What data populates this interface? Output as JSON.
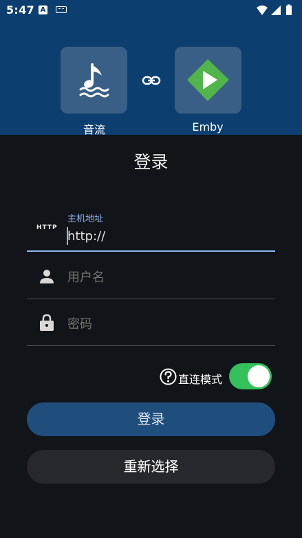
{
  "statusbar": {
    "time": "5:47",
    "notif_icon": "a-notification-icon",
    "keyboard_icon": "keyboard-icon",
    "wifi_icon": "wifi-icon",
    "signal_icon": "signal-icon",
    "battery_icon": "battery-icon"
  },
  "header": {
    "left_app": {
      "label": "音流",
      "icon": "music-note-wave-icon"
    },
    "right_app": {
      "label": "Emby",
      "icon": "emby-play-icon"
    },
    "link_icon": "link-icon",
    "colors": {
      "background": "#0c3f70",
      "tile": "#3a5f86",
      "emby_green": "#52b54b"
    }
  },
  "login": {
    "title": "登录",
    "host": {
      "label": "主机地址",
      "icon_text": "HTTP",
      "value": "http://"
    },
    "username": {
      "placeholder": "用户名"
    },
    "password": {
      "placeholder": "密码"
    },
    "direct_mode": {
      "label": "直连模式",
      "enabled": true
    },
    "login_button": "登录",
    "reselect_button": "重新选择"
  },
  "colors": {
    "page_bg": "#111418",
    "accent": "#8fb8ee",
    "switch_on": "#34c05a",
    "login_btn": "#1f4d7c",
    "secondary_btn": "#26282d"
  }
}
